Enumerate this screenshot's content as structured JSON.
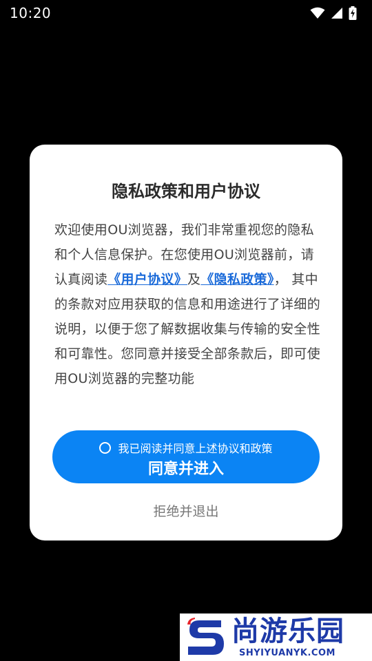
{
  "status_bar": {
    "time": "10:20",
    "icons": [
      "wifi-icon",
      "cellular-signal-icon",
      "battery-charging-icon"
    ]
  },
  "dialog": {
    "title": "隐私政策和用户协议",
    "body": {
      "intro": "欢迎使用OU浏览器，我们非常重视您的隐私和个人信息保护。在您使用OU浏览器前，请认真阅读",
      "user_agreement_link": "《用户协议》",
      "conjunction": "及",
      "privacy_policy_link": "《隐私政策》",
      "rest": "， 其中的条款对应用获取的信息和用途进行了详细的说明，以便于您了解数据收集与传输的安全性和可靠性。您同意并接受全部条款后，即可使用OU浏览器的完整功能"
    },
    "agree_checkbox_label": "我已阅读并同意上述协议和政策",
    "agree_checked": false,
    "agree_button_label": "同意并进入",
    "reject_button_label": "拒绝并退出"
  },
  "watermark": {
    "name": "尚游乐园",
    "domain": "SHYIYUANYK.COM"
  },
  "colors": {
    "background": "#000000",
    "dialog": "#ffffff",
    "primary_button": "#0b84f4",
    "link": "#1a6ad9",
    "watermark_text": "#1e3aa8",
    "watermark_accent": "#e8232a"
  }
}
